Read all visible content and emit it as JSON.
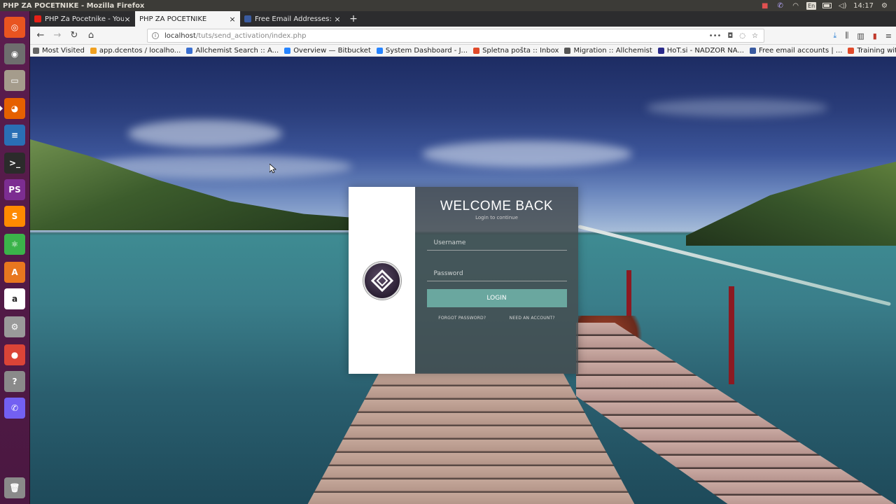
{
  "os": {
    "window_title": "PHP ZA POCETNIKE - Mozilla Firefox",
    "clock": "14:17",
    "keyboard_layout": "En"
  },
  "launcher": {
    "items": [
      {
        "name": "ubuntu-dash-icon",
        "color": "#e95420",
        "glyph": "◎"
      },
      {
        "name": "ubuntu-settings-icon",
        "color": "#6e6e6e",
        "glyph": "◉"
      },
      {
        "name": "files-icon",
        "color": "#a59c8c",
        "glyph": "▭"
      },
      {
        "name": "firefox-icon",
        "color": "#e66000",
        "glyph": "◕"
      },
      {
        "name": "writer-icon",
        "color": "#2a6fb5",
        "glyph": "≡"
      },
      {
        "name": "terminal-icon",
        "color": "#2b2b2b",
        "glyph": ">_"
      },
      {
        "name": "phpstorm-icon",
        "color": "#7c2d91",
        "glyph": "PS"
      },
      {
        "name": "sublime-icon",
        "color": "#ff8a00",
        "glyph": "S"
      },
      {
        "name": "atom-icon",
        "color": "#3bb34a",
        "glyph": "⚛"
      },
      {
        "name": "software-center-icon",
        "color": "#e8771f",
        "glyph": "A"
      },
      {
        "name": "amazon-icon",
        "color": "#ffffff",
        "glyph": "a"
      },
      {
        "name": "system-settings-icon",
        "color": "#9a9a9a",
        "glyph": "⚙"
      },
      {
        "name": "chrome-icon",
        "color": "#db4437",
        "glyph": "●"
      },
      {
        "name": "help-icon",
        "color": "#8a8a8a",
        "glyph": "?"
      },
      {
        "name": "viber-icon",
        "color": "#7360f2",
        "glyph": "✆"
      }
    ],
    "trash_icon": "trash-icon"
  },
  "browser": {
    "tabs": [
      {
        "label": "PHP Za Pocetnike - YouT",
        "icon_color": "#e62117"
      },
      {
        "label": "PHP ZA POCETNIKE",
        "icon_color": "transparent"
      },
      {
        "label": "Free Email Addresses: W",
        "icon_color": "#3a5ba0"
      }
    ],
    "new_tab_label": "+",
    "url": {
      "host": "localhost",
      "path": "/tuts/send_activation/index.php"
    },
    "bookmarks": [
      {
        "label": "Most Visited",
        "icon_color": "#666666"
      },
      {
        "label": "app.dcentos / localho...",
        "icon_color": "#f0a020"
      },
      {
        "label": "Allchemist Search :: A...",
        "icon_color": "#3a6fd0"
      },
      {
        "label": "Overview — Bitbucket",
        "icon_color": "#2684ff"
      },
      {
        "label": "System Dashboard - J...",
        "icon_color": "#2684ff"
      },
      {
        "label": "Spletna pošta :: Inbox",
        "icon_color": "#e04a2a"
      },
      {
        "label": "Migration :: Allchemist",
        "icon_color": "#555555"
      },
      {
        "label": "HoT.si - NADZOR NA...",
        "icon_color": "#2a2a8a"
      },
      {
        "label": "Free email accounts | ...",
        "icon_color": "#3a5ba0"
      },
      {
        "label": "Training with Live Pr...",
        "icon_color": "#e04a2a"
      }
    ]
  },
  "login": {
    "title": "WELCOME BACK",
    "subtitle": "Login to continue",
    "username_placeholder": "Username",
    "password_placeholder": "Password",
    "login_label": "LOGIN",
    "forgot_label": "FORGOT PASSWORD?",
    "register_label": "NEED AN ACCOUNT?",
    "accent_color": "#6aa79f"
  }
}
